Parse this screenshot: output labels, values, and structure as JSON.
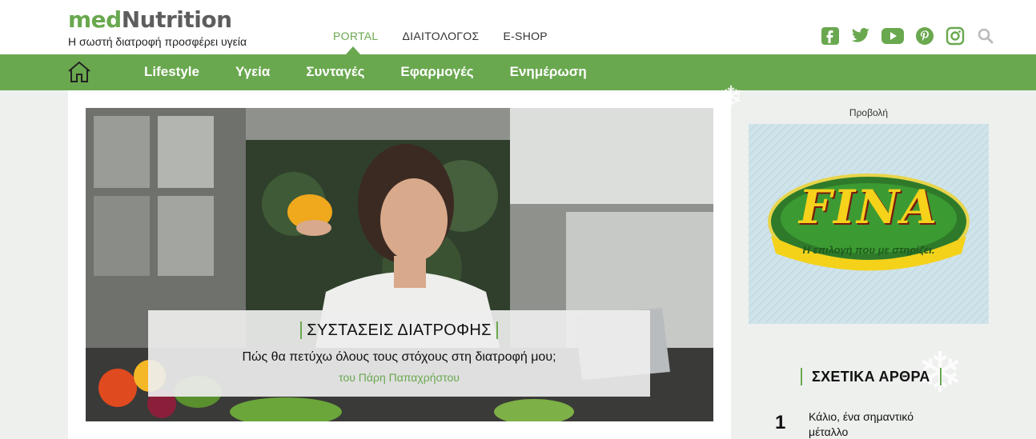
{
  "header": {
    "logo": {
      "part1": "med",
      "part2": "Nutrition"
    },
    "tagline": "Η σωστή διατροφή προσφέρει υγεία",
    "top_nav": [
      {
        "label": "PORTAL",
        "active": true
      },
      {
        "label": "ΔΙΑΙΤΟΛΟΓΟΣ",
        "active": false
      },
      {
        "label": "E-SHOP",
        "active": false
      }
    ],
    "social_icons": [
      "facebook-icon",
      "twitter-icon",
      "youtube-icon",
      "pinterest-icon",
      "instagram-icon",
      "search-icon"
    ]
  },
  "main_nav": {
    "home_icon": "home-icon",
    "items": [
      "Lifestyle",
      "Υγεία",
      "Συνταγές",
      "Εφαρμογές",
      "Ενημέρωση"
    ]
  },
  "hero": {
    "category": "ΣΥΣΤΑΣΕΙΣ ΔΙΑΤΡΟΦΗΣ",
    "title": "Πώς θα πετύχω όλους τους στόχους στη διατροφή μου;",
    "author": "του Πάρη Παπαχρήστου"
  },
  "sidebar": {
    "ad_label": "Προβολή",
    "ad_brand": "FINA",
    "ad_slogan": "Η επιλογή που με στηρίζει.",
    "related_title": "ΣΧΕΤΙΚΑ ΑΡΘΡΑ",
    "related": [
      {
        "num": "1",
        "title": "Κάλιο, ένα σημαντικό μέταλλο"
      }
    ]
  },
  "colors": {
    "brand_green": "#6aa84f",
    "background": "#eef0ee"
  }
}
